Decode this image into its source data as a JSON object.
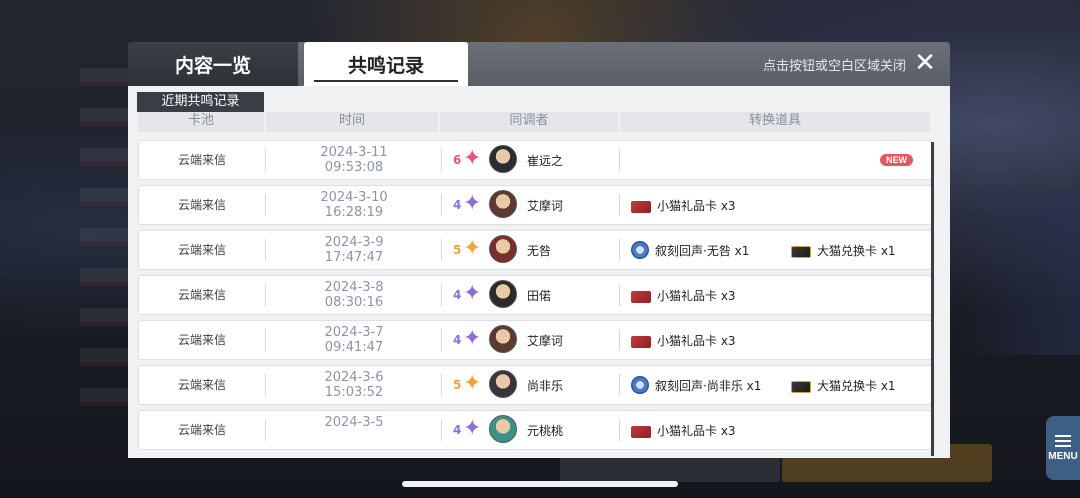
{
  "tabs": [
    {
      "label": "内容一览",
      "active": false
    },
    {
      "label": "共鸣记录",
      "active": true
    }
  ],
  "close_hint": "点击按钮或空白区域关闭",
  "close_icon": "✕",
  "section_label": "近期共鸣记录",
  "columns": {
    "pool": "卡池",
    "time": "时间",
    "tuner": "同调者",
    "items": "转换道具"
  },
  "menu_label": "MENU",
  "new_badge": "NEW",
  "colors": {
    "rank6": "#e8557e",
    "rank5": "#f2a43a",
    "rank4": "#8b6fd6"
  },
  "records": [
    {
      "pool": "云端来信",
      "date": "2024-3-11",
      "clock": "09:53:08",
      "rank": "6",
      "name": "崔远之",
      "items": [],
      "new": true
    },
    {
      "pool": "云端来信",
      "date": "2024-3-10",
      "clock": "16:28:19",
      "rank": "4",
      "name": "艾摩诃",
      "items": [
        {
          "icon": "card-red",
          "label": "小猫礼品卡 x3"
        }
      ]
    },
    {
      "pool": "云端来信",
      "date": "2024-3-9",
      "clock": "17:47:47",
      "rank": "5",
      "name": "无咎",
      "items": [
        {
          "icon": "disc",
          "label": "叙刻回声·无咎 x1"
        },
        {
          "icon": "card-dark",
          "label": "大猫兑换卡 x1"
        }
      ]
    },
    {
      "pool": "云端来信",
      "date": "2024-3-8",
      "clock": "08:30:16",
      "rank": "4",
      "name": "田偌",
      "items": [
        {
          "icon": "card-red",
          "label": "小猫礼品卡 x3"
        }
      ]
    },
    {
      "pool": "云端来信",
      "date": "2024-3-7",
      "clock": "09:41:47",
      "rank": "4",
      "name": "艾摩诃",
      "items": [
        {
          "icon": "card-red",
          "label": "小猫礼品卡 x3"
        }
      ]
    },
    {
      "pool": "云端来信",
      "date": "2024-3-6",
      "clock": "15:03:52",
      "rank": "5",
      "name": "尚非乐",
      "items": [
        {
          "icon": "disc",
          "label": "叙刻回声·尚非乐 x1"
        },
        {
          "icon": "card-dark",
          "label": "大猫兑换卡 x1"
        }
      ]
    },
    {
      "pool": "云端来信",
      "date": "2024-3-5",
      "clock": "",
      "rank": "4",
      "name": "元桃桃",
      "items": [
        {
          "icon": "card-red",
          "label": "小猫礼品卡 x3"
        }
      ]
    }
  ]
}
